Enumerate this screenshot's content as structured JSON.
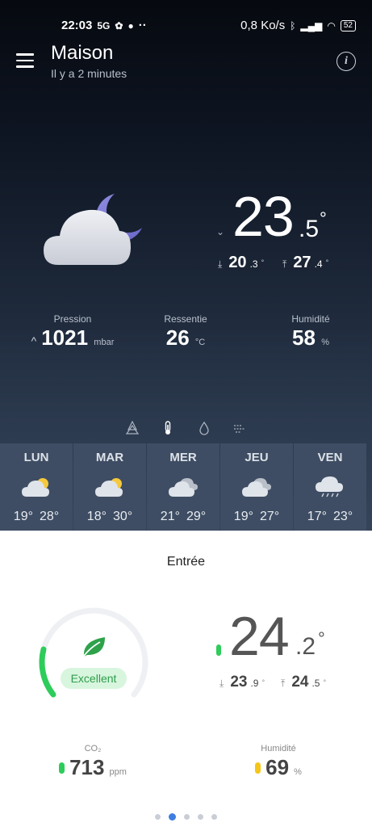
{
  "status_bar": {
    "time": "22:03",
    "left_extra": "··",
    "net_speed": "0,8 Ko/s",
    "battery": "52"
  },
  "header": {
    "title": "Maison",
    "subtitle": "Il y a 2 minutes",
    "info_symbol": "i"
  },
  "current": {
    "weather_icon": "cloud-moon-icon",
    "temp_int": "23",
    "temp_dec": ".5",
    "temp_unit": "°",
    "min_int": "20",
    "min_dec": ".3",
    "max_int": "27",
    "max_dec": ".4",
    "deg_symbol": "°"
  },
  "stats": {
    "pressure": {
      "label": "Pression",
      "value": "1021",
      "unit": "mbar",
      "trend": "^"
    },
    "feels_like": {
      "label": "Ressentie",
      "value": "26",
      "unit": "°C"
    },
    "humidity": {
      "label": "Humidité",
      "value": "58",
      "unit": "%"
    }
  },
  "forecast": [
    {
      "day": "LUN",
      "icon": "sun-cloud-icon",
      "min": "19°",
      "max": "28°"
    },
    {
      "day": "MAR",
      "icon": "sun-cloud-icon",
      "min": "18°",
      "max": "30°"
    },
    {
      "day": "MER",
      "icon": "cloudy-icon",
      "min": "21°",
      "max": "29°"
    },
    {
      "day": "JEU",
      "icon": "cloudy-icon",
      "min": "19°",
      "max": "27°"
    },
    {
      "day": "VEN",
      "icon": "rain-cloud-icon",
      "min": "17°",
      "max": "23°"
    }
  ],
  "indoor": {
    "room": "Entrée",
    "quality": "Excellent",
    "temp_int": "24",
    "temp_dec": ".2",
    "temp_unit": "°",
    "min_int": "23",
    "min_dec": ".9",
    "max_int": "24",
    "max_dec": ".5",
    "deg_symbol": "°",
    "co2": {
      "label": "CO₂",
      "value": "713",
      "unit": "ppm",
      "color": "#2ecc5a"
    },
    "humidity": {
      "label": "Humidité",
      "value": "69",
      "unit": "%",
      "color": "#f5c518"
    }
  },
  "pagination": {
    "count": 5,
    "active": 1
  },
  "colors": {
    "accent_green": "#2ecc5a",
    "badge_bg": "#d8f5de",
    "active_dot": "#3f7de0"
  }
}
